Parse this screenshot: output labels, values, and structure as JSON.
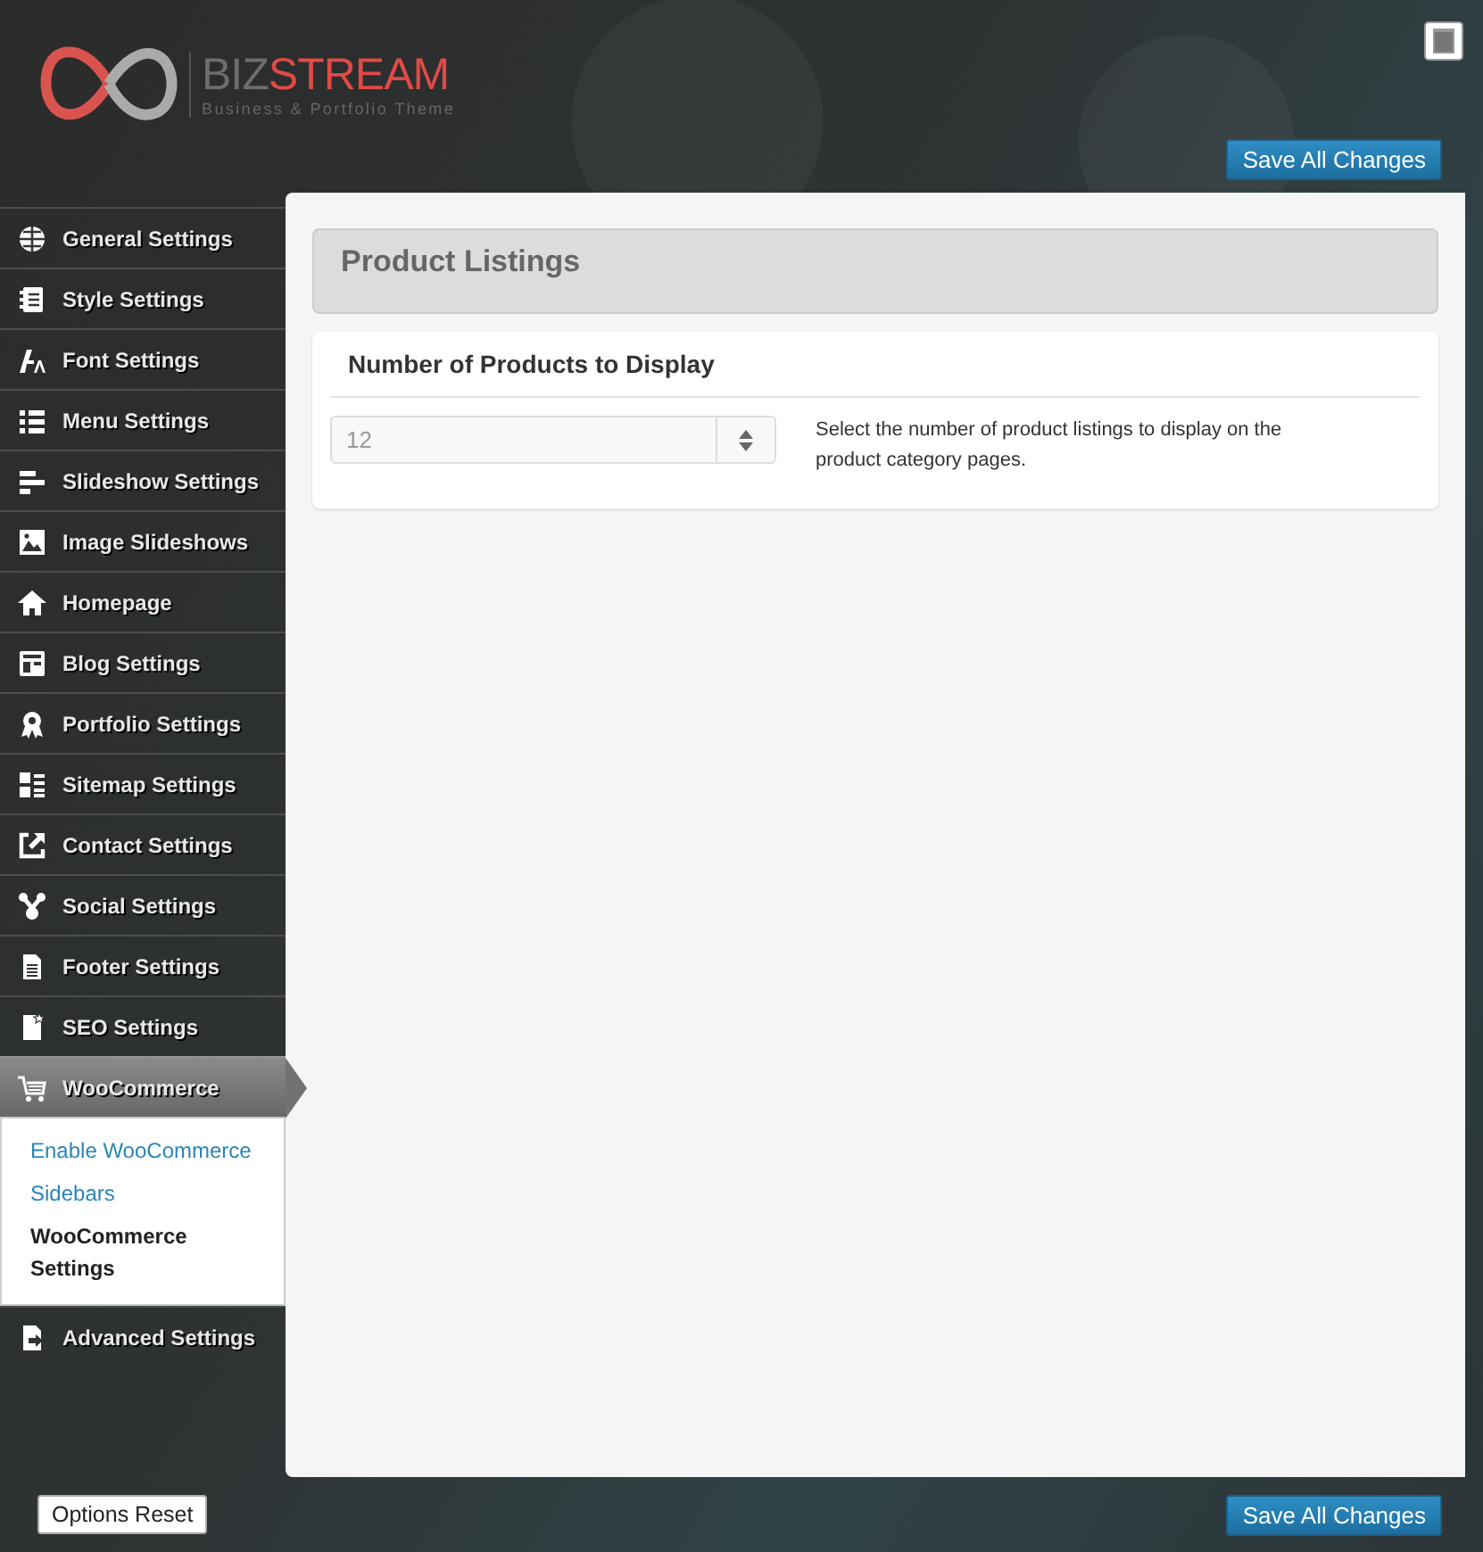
{
  "logo": {
    "word_part_1": "BIZ",
    "word_part_2": "STREAM",
    "tagline": "Business & Portfolio Theme"
  },
  "save_button_top": "Save All Changes",
  "sidebar": {
    "items": [
      {
        "label": "General Settings",
        "selected": false
      },
      {
        "label": "Style Settings",
        "selected": false
      },
      {
        "label": "Font Settings",
        "selected": false
      },
      {
        "label": "Menu Settings",
        "selected": false
      },
      {
        "label": "Slideshow Settings",
        "selected": false
      },
      {
        "label": "Image Slideshows",
        "selected": false
      },
      {
        "label": "Homepage",
        "selected": false
      },
      {
        "label": "Blog Settings",
        "selected": false
      },
      {
        "label": "Portfolio Settings",
        "selected": false
      },
      {
        "label": "Sitemap Settings",
        "selected": false
      },
      {
        "label": "Contact Settings",
        "selected": false
      },
      {
        "label": "Social Settings",
        "selected": false
      },
      {
        "label": "Footer Settings",
        "selected": false
      },
      {
        "label": "SEO Settings",
        "selected": false
      },
      {
        "label": "WooCommerce",
        "selected": true,
        "expanded": true,
        "children": [
          {
            "label": "Enable WooCommerce",
            "selected": false
          },
          {
            "label": "Sidebars",
            "selected": false
          },
          {
            "label": "WooCommerce Settings",
            "selected": true
          }
        ]
      },
      {
        "label": "Advanced Settings",
        "selected": false
      }
    ]
  },
  "section": {
    "title": "Product Listings",
    "option": {
      "title": "Number of Products to Display",
      "value": "12",
      "description": "Select the number of product listings to display on the product category pages."
    }
  },
  "footer": {
    "reset_button": "Options Reset",
    "save_button": "Save All Changes"
  }
}
